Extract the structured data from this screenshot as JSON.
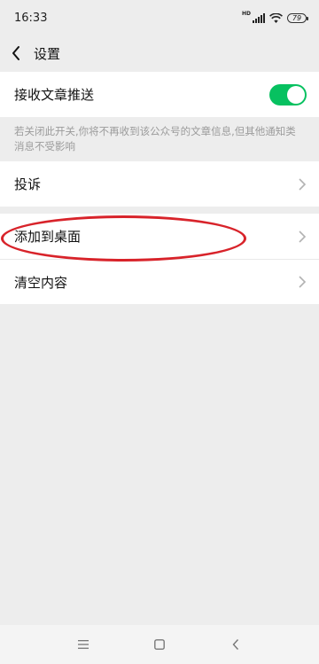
{
  "status": {
    "time": "16:33",
    "network_label": "HD",
    "battery": "79"
  },
  "nav": {
    "title": "设置"
  },
  "settings": {
    "push_label": "接收文章推送",
    "push_enabled": true,
    "hint": "若关闭此开关,你将不再收到该公众号的文章信息,但其他通知类消息不受影响",
    "complaint_label": "投诉",
    "add_desktop_label": "添加到桌面",
    "clear_label": "清空内容"
  },
  "colors": {
    "accent": "#07c160",
    "highlight": "#d8232a",
    "background": "#ededed"
  },
  "icons": {
    "back": "back-chevron-icon",
    "row_arrow": "chevron-right-icon",
    "signal": "signal-icon",
    "wifi": "wifi-icon",
    "battery": "battery-icon",
    "system_menu": "menu-icon",
    "system_home": "home-square-icon",
    "system_back": "back-triangle-icon"
  }
}
